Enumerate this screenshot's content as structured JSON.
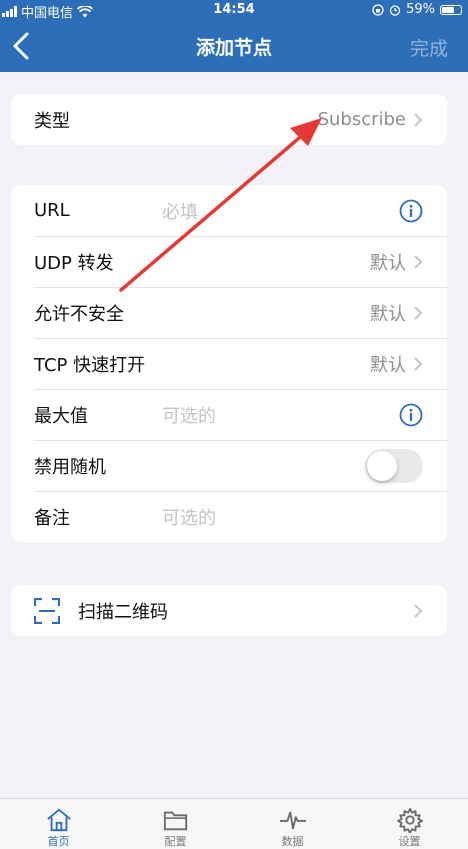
{
  "status_bar": {
    "carrier": "中国电信",
    "time": "14:54",
    "battery": "59%"
  },
  "nav": {
    "title": "添加节点",
    "done_label": "完成"
  },
  "type_row": {
    "label": "类型",
    "value": "Subscribe"
  },
  "form": {
    "url": {
      "label": "URL",
      "placeholder": "必填"
    },
    "udp": {
      "label": "UDP 转发",
      "value": "默认"
    },
    "insecure": {
      "label": "允许不安全",
      "value": "默认"
    },
    "tfo": {
      "label": "TCP 快速打开",
      "value": "默认"
    },
    "max": {
      "label": "最大值",
      "placeholder": "可选的"
    },
    "disable_random": {
      "label": "禁用随机",
      "enabled": false
    },
    "note": {
      "label": "备注",
      "placeholder": "可选的"
    }
  },
  "scan": {
    "label": "扫描二维码"
  },
  "tabs": [
    {
      "label": "首页",
      "icon": "home-icon",
      "active": true
    },
    {
      "label": "配置",
      "icon": "folder-icon",
      "active": false
    },
    {
      "label": "数据",
      "icon": "activity-icon",
      "active": false
    },
    {
      "label": "设置",
      "icon": "gear-icon",
      "active": false
    }
  ],
  "colors": {
    "accent": "#2d6eb8",
    "annotation_arrow": "#e53935"
  }
}
